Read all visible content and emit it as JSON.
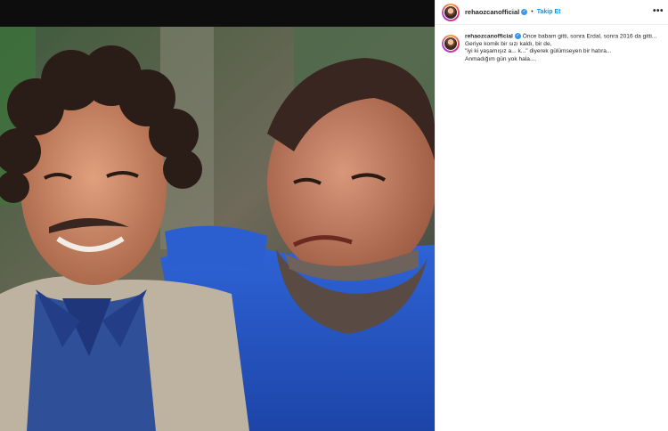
{
  "post": {
    "username": "rehaozcanofficial",
    "follow_label": "Takip Et",
    "dot": "•",
    "verified_glyph": "✓",
    "more_glyph": "•••",
    "caption": {
      "first_line": "Önce babam gitti, sonra Erdal, sonra 2016 da gitti...",
      "lines": [
        "Geriye komik bir sızı kaldı, bir de,",
        "\"iyi ki yaşamışız a... k...\" diyerek gülümseyen bir hatıra...",
        "Anmadığım gün yok hala...."
      ]
    }
  },
  "colors": {
    "accent": "#0095f6",
    "verified": "#3897f0",
    "text": "#262626"
  },
  "icons": [
    "avatar",
    "verified-badge-icon",
    "more-options-icon"
  ]
}
